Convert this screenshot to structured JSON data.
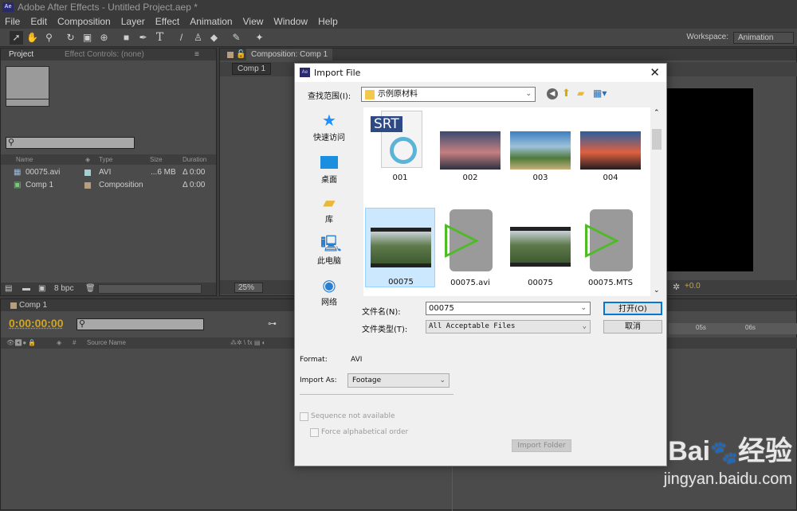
{
  "app": {
    "title": "Adobe After Effects - Untitled Project.aep *",
    "logo": "Ae"
  },
  "menu": [
    "File",
    "Edit",
    "Composition",
    "Layer",
    "Effect",
    "Animation",
    "View",
    "Window",
    "Help"
  ],
  "toolbar": {
    "tools": [
      "selection-tool",
      "hand-tool",
      "zoom-tool",
      "rotate-tool",
      "camera-tool",
      "pan-behind-tool",
      "rectangle-tool",
      "pen-tool",
      "type-tool",
      "brush-tool",
      "clone-stamp-tool",
      "eraser-tool",
      "roto-brush-tool",
      "puppet-pin-tool"
    ],
    "workspace_label": "Workspace:",
    "workspace_value": "Animation"
  },
  "project_panel": {
    "tabs": [
      "Project",
      "Effect Controls: (none)"
    ],
    "search_placeholder": "",
    "columns": [
      "Name",
      "Type",
      "Size",
      "Duration"
    ],
    "items": [
      {
        "name": "00075.avi",
        "type": "AVI",
        "size": "...6 MB",
        "duration": "Δ 0:00",
        "color": "#a6cfcf"
      },
      {
        "name": "Comp 1",
        "type": "Composition",
        "size": "",
        "duration": "Δ 0:00",
        "color": "#b59f7f"
      }
    ],
    "bpc": "8 bpc"
  },
  "comp_panel": {
    "tab": "Composition: Comp 1",
    "sub_tab": "Comp 1",
    "zoom": "25%",
    "exposure": "+0.0"
  },
  "timeline": {
    "tab": "Comp 1",
    "timecode": "0:00:00:00",
    "column": "Source Name",
    "column_hash": "#",
    "ruler": [
      "05s",
      "06s"
    ]
  },
  "dialog": {
    "title": "Import File",
    "look_in_label": "查找范围(I):",
    "look_in_value": "示例原材料",
    "places": [
      {
        "label": "快速访问",
        "icon": "star-icon"
      },
      {
        "label": "桌面",
        "icon": "desktop-icon"
      },
      {
        "label": "库",
        "icon": "library-icon"
      },
      {
        "label": "此电脑",
        "icon": "computer-icon"
      },
      {
        "label": "网络",
        "icon": "network-icon"
      }
    ],
    "files": [
      {
        "name": "001",
        "kind": "srt"
      },
      {
        "name": "002",
        "kind": "image"
      },
      {
        "name": "003",
        "kind": "image"
      },
      {
        "name": "004",
        "kind": "image"
      },
      {
        "name": "00075",
        "kind": "video",
        "selected": true
      },
      {
        "name": "00075.avi",
        "kind": "media"
      },
      {
        "name": "00075",
        "kind": "video"
      },
      {
        "name": "00075.MTS",
        "kind": "media"
      }
    ],
    "srt_badge": "SRT",
    "file_name_label": "文件名(N):",
    "file_name_value": "00075",
    "file_type_label": "文件类型(T):",
    "file_type_value": "All Acceptable Files",
    "open_label": "打开(O)",
    "cancel_label": "取消",
    "format_label": "Format:",
    "format_value": "AVI",
    "import_as_label": "Import As:",
    "import_as_value": "Footage",
    "sequence_label": "Sequence not available",
    "force_alpha_label": "Force alphabetical order",
    "import_folder_label": "Import Folder"
  },
  "watermark": {
    "brand": "Baidu 经验",
    "url": "jingyan.baidu.com"
  }
}
